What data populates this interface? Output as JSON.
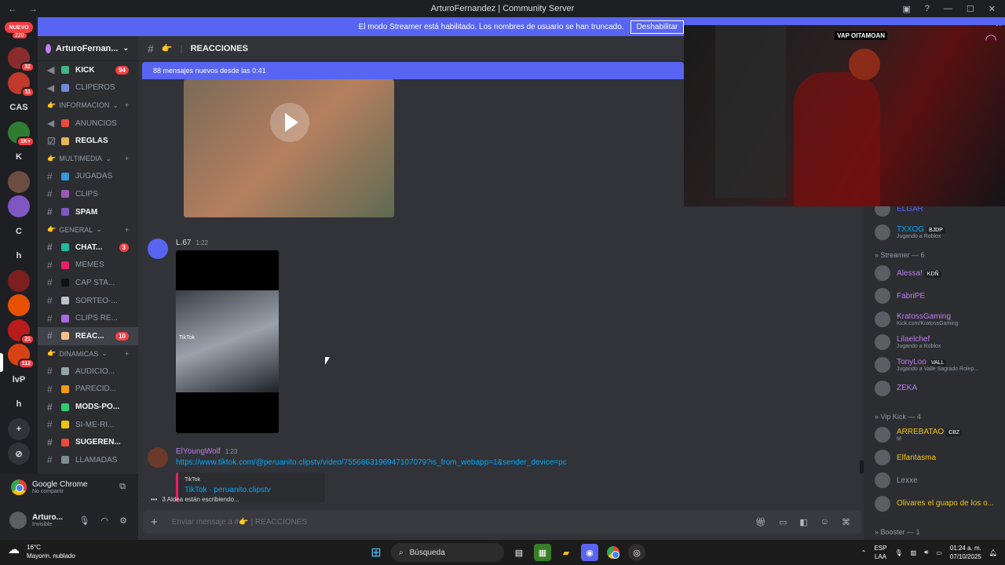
{
  "window": {
    "title": "ArturoFernandez | Community Server"
  },
  "banner": {
    "text": "El modo Streamer está habilitado. Los nombres de usuario se han truncado.",
    "button": "Deshabilitar"
  },
  "guilds": {
    "new_label": "NUEVO",
    "new_count": "220",
    "items": [
      {
        "label": "",
        "badge": "32",
        "color": "#8b2c2c"
      },
      {
        "label": "",
        "badge": "11",
        "color": "#c0392b"
      },
      {
        "label": "CAS",
        "badge": "",
        "color": "#1e1f22"
      },
      {
        "label": "",
        "badge": "1K+",
        "color": "#2e7d32"
      },
      {
        "label": "K",
        "badge": "",
        "color": "#1e1f22"
      },
      {
        "label": "",
        "badge": "",
        "color": "#6d4c41"
      },
      {
        "label": "",
        "badge": "",
        "color": "#7e57c2"
      },
      {
        "label": "C",
        "badge": "",
        "color": "#1e1f22"
      },
      {
        "label": "h",
        "badge": "",
        "color": "#1e1f22"
      },
      {
        "label": "",
        "badge": "",
        "color": "#7b1f1f"
      },
      {
        "label": "",
        "badge": "",
        "color": "#e65100"
      },
      {
        "label": "",
        "badge": "21",
        "color": "#b71c1c"
      },
      {
        "label": "",
        "badge": "112",
        "color": "#d84315"
      },
      {
        "label": "lvP",
        "badge": "",
        "color": "#1e1f22"
      },
      {
        "label": "h",
        "badge": "",
        "color": "#1e1f22"
      },
      {
        "label": "+",
        "badge": "",
        "color": "#313338"
      },
      {
        "label": "⊘",
        "badge": "",
        "color": "#313338"
      }
    ]
  },
  "server": {
    "name": "ArturoFernan...",
    "channels": [
      {
        "type": "channel",
        "icon": "megaphone-icon",
        "emoji_color": "#43b581",
        "label": "KICK",
        "bold": true,
        "count": "94"
      },
      {
        "type": "channel",
        "icon": "megaphone-icon",
        "emoji_color": "#7289da",
        "label": "CLIPEROS",
        "bold": false,
        "count": ""
      },
      {
        "type": "category",
        "label": "INFORMACION"
      },
      {
        "type": "channel",
        "icon": "megaphone-icon",
        "emoji_color": "#e74c3c",
        "label": "ANUNCIOS",
        "bold": false,
        "count": ""
      },
      {
        "type": "channel",
        "icon": "check-icon",
        "emoji_color": "#e6b35c",
        "label": "REGLAS",
        "bold": true,
        "count": ""
      },
      {
        "type": "category",
        "label": "MULTIMEDIA"
      },
      {
        "type": "channel",
        "icon": "hash-icon",
        "emoji_color": "#3498db",
        "label": "JUGADAS",
        "bold": false,
        "count": ""
      },
      {
        "type": "channel",
        "icon": "hash-icon",
        "emoji_color": "#9b59b6",
        "label": "CLIPS",
        "bold": false,
        "count": ""
      },
      {
        "type": "channel",
        "icon": "hash-icon",
        "emoji_color": "#7e57c2",
        "label": "SPAM",
        "bold": true,
        "count": ""
      },
      {
        "type": "category",
        "label": "GENERAL"
      },
      {
        "type": "channel",
        "icon": "hash-icon",
        "emoji_color": "#1abc9c",
        "label": "CHAT...",
        "bold": true,
        "count": "3"
      },
      {
        "type": "channel",
        "icon": "hash-icon",
        "emoji_color": "#e91e63",
        "label": "MEMES",
        "bold": false,
        "count": ""
      },
      {
        "type": "channel",
        "icon": "hash-icon",
        "emoji_color": "#111111",
        "label": "CAP STA...",
        "bold": false,
        "count": ""
      },
      {
        "type": "channel",
        "icon": "hash-icon",
        "emoji_color": "#bdc3c7",
        "label": "SORTEO-...",
        "bold": false,
        "count": ""
      },
      {
        "type": "channel",
        "icon": "hash-icon",
        "emoji_color": "#a66bde",
        "label": "CLIPS RE...",
        "bold": false,
        "count": ""
      },
      {
        "type": "channel",
        "icon": "hash-icon",
        "emoji_color": "#f5c28a",
        "label": "REAC...",
        "bold": true,
        "count": "10",
        "selected": true
      },
      {
        "type": "category",
        "label": "DINAMICAS"
      },
      {
        "type": "channel",
        "icon": "hash-icon",
        "emoji_color": "#95a5a6",
        "label": "AUDICIO...",
        "bold": false,
        "count": ""
      },
      {
        "type": "channel",
        "icon": "hash-icon",
        "emoji_color": "#f39c12",
        "label": "PARECID...",
        "bold": false,
        "count": ""
      },
      {
        "type": "channel",
        "icon": "hash-icon",
        "emoji_color": "#2ecc71",
        "label": "MODS-PO...",
        "bold": true,
        "count": ""
      },
      {
        "type": "channel",
        "icon": "hash-icon",
        "emoji_color": "#f1c40f",
        "label": "SI-ME-RI...",
        "bold": false,
        "count": ""
      },
      {
        "type": "channel",
        "icon": "hash-icon",
        "emoji_color": "#e74c3c",
        "label": "SUGEREN...",
        "bold": true,
        "count": ""
      },
      {
        "type": "channel",
        "icon": "hash-icon",
        "emoji_color": "#7f8c8d",
        "label": "LLAMADAS",
        "bold": false,
        "count": ""
      }
    ]
  },
  "activity": {
    "app": "Google Chrome",
    "status": "No compartir"
  },
  "user": {
    "name": "Arturo...",
    "status": "Invisible"
  },
  "channel_header": {
    "name": "REACCIONES"
  },
  "new_messages": "88 mensajes nuevos desde las 0:41",
  "messages": [
    {
      "author": "L.67",
      "time": "1:22",
      "author_color": "#dbdee1"
    },
    {
      "author": "ElYoungWolf",
      "time": "1:23",
      "author_color": "#c27ef0",
      "link": "https://www.tiktok.com/@peruanito.clipstv/video/7556863196947107079?is_from_webapp=1&sender_device=pc",
      "embed_provider": "TikTok",
      "embed_title": "TikTok · peruanito.clipstv"
    }
  ],
  "video_label": "TikTok",
  "typing": "3 Aldea están escribiendo...",
  "composer": {
    "placeholder": "Enviar mensaje a #👉 | REACCIONES"
  },
  "members": {
    "top": [
      {
        "name": "ELGAR",
        "color": "#5865f2",
        "sub": ""
      },
      {
        "name": "TXXOG",
        "color": "#00a8fc",
        "tag": "BJDP",
        "sub": "Jugando a Roblox"
      }
    ],
    "sections": [
      {
        "title": "» Streamer — 6",
        "items": [
          {
            "name": "Alessa!",
            "color": "#c27ef0",
            "tag": "KDÑ",
            "sub": ""
          },
          {
            "name": "FabriPE",
            "color": "#c27ef0",
            "sub": ""
          },
          {
            "name": "KratossGaming",
            "color": "#c27ef0",
            "sub": "Kick.com/KratossGaming"
          },
          {
            "name": "Lilaelchef",
            "color": "#c27ef0",
            "sub": "Jugando a Roblox"
          },
          {
            "name": "TonyLoo",
            "color": "#c27ef0",
            "tag": "VALL",
            "sub": "Jugando a Valle Sagrado Rolep..."
          },
          {
            "name": "ZEKA",
            "color": "#c27ef0",
            "sub": ""
          }
        ]
      },
      {
        "title": "» Vip Kick — 4",
        "items": [
          {
            "name": "ARREBATAO",
            "color": "#f1c40f",
            "tag": "CBZ",
            "sub": "M"
          },
          {
            "name": "Elfantasma",
            "color": "#f1c40f",
            "sub": ""
          },
          {
            "name": "Lexxe",
            "color": "#949ba4",
            "sub": ""
          },
          {
            "name": "Olivares el guapo de los o...",
            "color": "#f1c40f",
            "sub": ""
          }
        ]
      },
      {
        "title": "» Booster — 1",
        "items": []
      }
    ]
  },
  "stream": {
    "label": "VAP OITAMOAN"
  },
  "taskbar": {
    "temp": "16°C",
    "weather": "Mayorm. nublado",
    "search": "Búsqueda",
    "lang": "ESP",
    "lang2": "LAA",
    "time": "01:24 a. m.",
    "date": "07/10/2025"
  }
}
